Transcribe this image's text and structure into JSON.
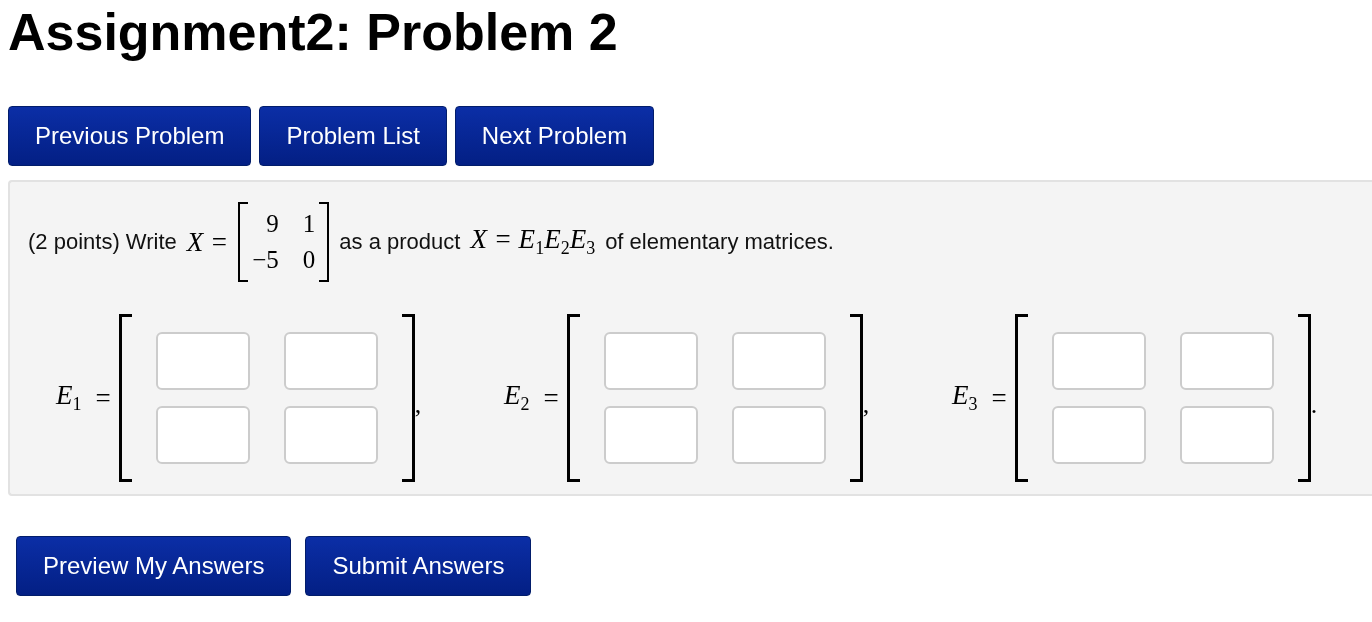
{
  "title": "Assignment2: Problem 2",
  "nav_buttons": [
    "Previous Problem",
    "Problem List",
    "Next Problem"
  ],
  "problem": {
    "intro": "(2 points) Write",
    "lhs": "X =",
    "matrix": [
      [
        "9",
        "1"
      ],
      [
        "−5",
        "0"
      ]
    ],
    "middle": "as a product",
    "equation": "X = E$_{1}$E$_{2}$E$_{3}$",
    "tail": "of elementary matrices."
  },
  "answers": [
    {
      "label": "E$_{1}$",
      "equals": "=",
      "punct": ","
    },
    {
      "label": "E$_{2}$",
      "equals": "=",
      "punct": ","
    },
    {
      "label": "E$_{3}$",
      "equals": "=",
      "punct": "."
    }
  ],
  "action_buttons": [
    "Preview My Answers",
    "Submit Answers"
  ]
}
